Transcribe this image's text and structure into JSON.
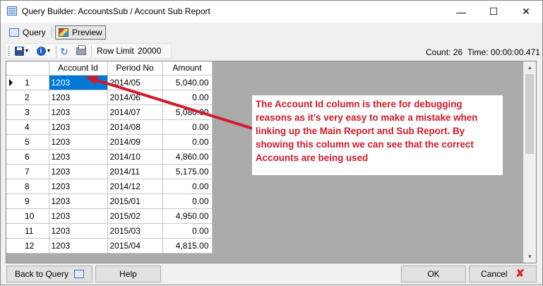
{
  "window": {
    "title": "Query Builder:  AccountsSub / Account Sub Report",
    "minimize_glyph": "—",
    "maximize_glyph": "☐",
    "close_glyph": "✕"
  },
  "tabs": [
    {
      "label": "Query",
      "icon": "query-icon"
    },
    {
      "label": "Preview",
      "icon": "preview-icon",
      "active": true
    }
  ],
  "toolbar": {
    "row_limit_label": "Row Limit",
    "row_limit_value": "20000",
    "info_glyph": "i",
    "refresh_glyph": "↻"
  },
  "status": {
    "count": "Count: 26",
    "time": "Time: 00:00:00.471"
  },
  "grid": {
    "columns": [
      "Account Id",
      "Period No",
      "Amount"
    ],
    "rows": [
      {
        "n": "1",
        "account_id": "1203",
        "period": "2014/05",
        "amount": "5,040.00"
      },
      {
        "n": "2",
        "account_id": "1203",
        "period": "2014/06",
        "amount": "0.00"
      },
      {
        "n": "3",
        "account_id": "1203",
        "period": "2014/07",
        "amount": "5,080.00"
      },
      {
        "n": "4",
        "account_id": "1203",
        "period": "2014/08",
        "amount": "0.00"
      },
      {
        "n": "5",
        "account_id": "1203",
        "period": "2014/09",
        "amount": "0.00"
      },
      {
        "n": "6",
        "account_id": "1203",
        "period": "2014/10",
        "amount": "4,860.00"
      },
      {
        "n": "7",
        "account_id": "1203",
        "period": "2014/11",
        "amount": "5,175.00"
      },
      {
        "n": "8",
        "account_id": "1203",
        "period": "2014/12",
        "amount": "0.00"
      },
      {
        "n": "9",
        "account_id": "1203",
        "period": "2015/01",
        "amount": "0.00"
      },
      {
        "n": "10",
        "account_id": "1203",
        "period": "2015/02",
        "amount": "4,950.00"
      },
      {
        "n": "11",
        "account_id": "1203",
        "period": "2015/03",
        "amount": "0.00"
      },
      {
        "n": "12",
        "account_id": "1203",
        "period": "2015/04",
        "amount": "4,815.00"
      }
    ]
  },
  "annotation": {
    "text": "The Account Id column is there for debugging reasons as it's very easy to make a mistake when linking up the Main Report and Sub Report.  By showing this column we can see that the correct Accounts are being used",
    "color": "#d11a2a"
  },
  "buttons": {
    "back": "Back to Query",
    "help": "Help",
    "ok": "OK",
    "cancel": "Cancel",
    "cancel_glyph": "✘"
  }
}
